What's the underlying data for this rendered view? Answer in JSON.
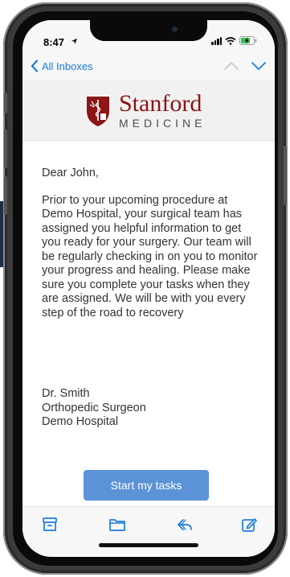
{
  "status_bar": {
    "time": "8:47"
  },
  "nav": {
    "back_label": "All Inboxes"
  },
  "logo": {
    "primary": "Stanford",
    "secondary": "MEDICINE"
  },
  "email": {
    "greeting": "Dear John,",
    "message": "Prior to your upcoming procedure at Demo Hospital, your surgical team has assigned you helpful information to get you ready for your surgery. Our team will be regularly checking in on you to monitor your progress and healing. Please make sure you complete your tasks when they are assigned. We will be with you every step of the road to recovery",
    "signature": {
      "name": "Dr. Smith",
      "title": "Orthopedic Surgeon",
      "organization": "Demo Hospital"
    },
    "cta_label": "Start my tasks"
  },
  "toolbar": {
    "icons": [
      "archive-icon",
      "folder-icon",
      "reply-icon",
      "compose-icon"
    ]
  },
  "colors": {
    "accent": "#1a7ce3",
    "button": "#5b93d6",
    "brand": "#8c1515"
  }
}
